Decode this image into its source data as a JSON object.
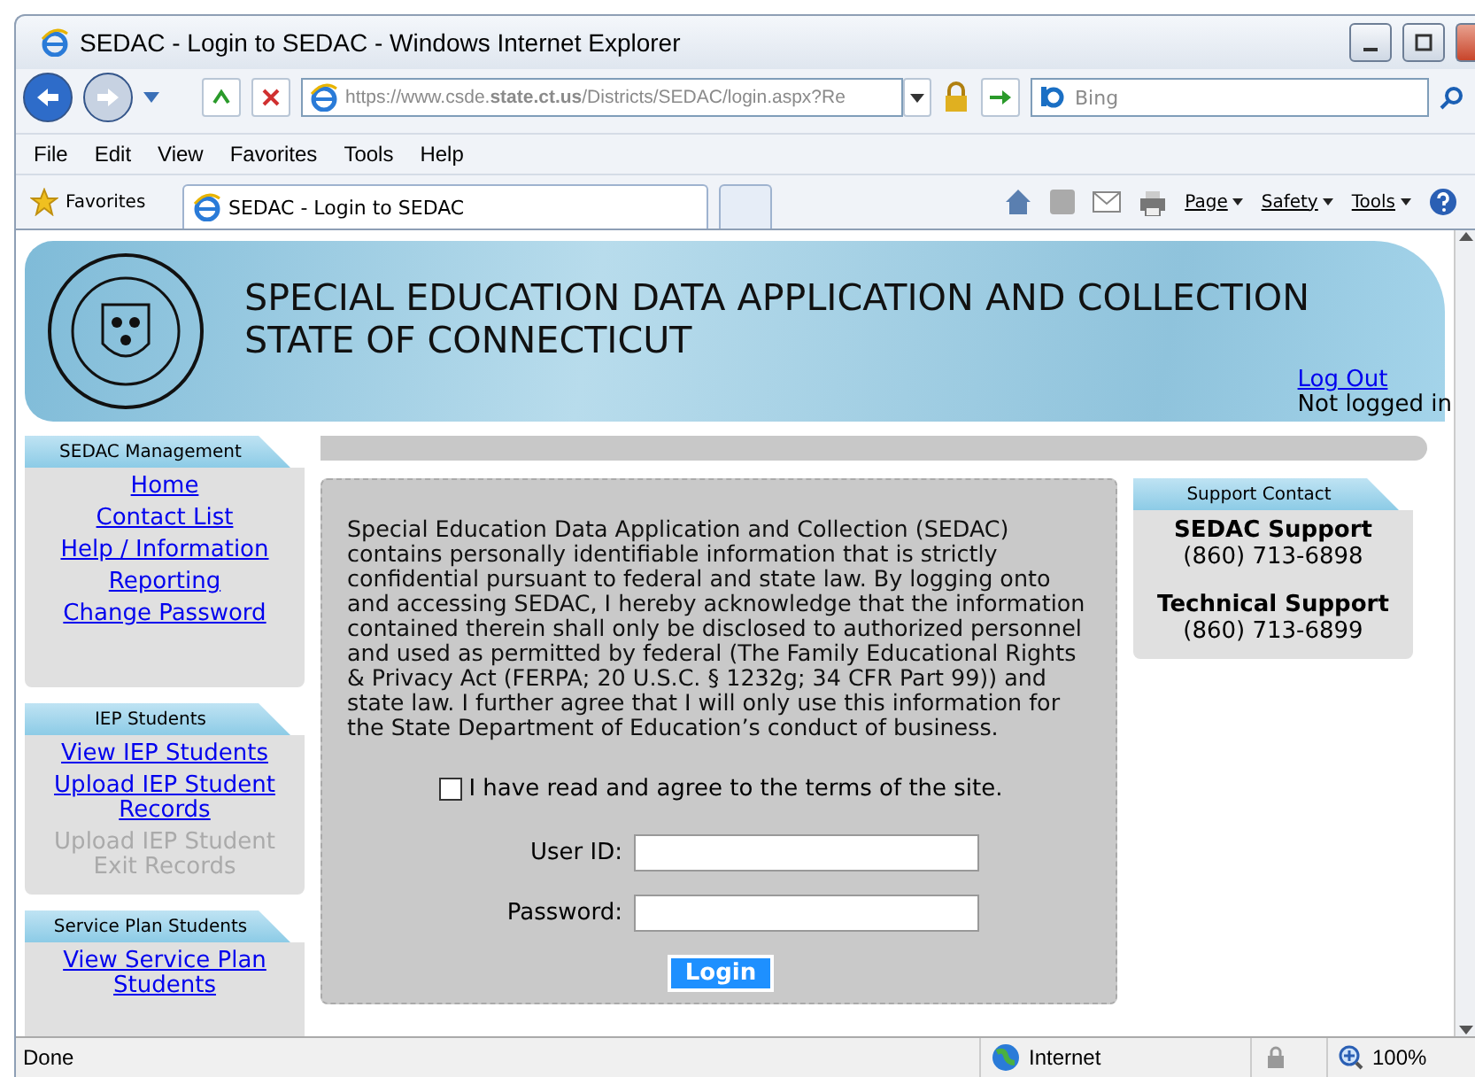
{
  "window": {
    "title": "SEDAC - Login to SEDAC - Windows Internet Explorer"
  },
  "address_bar": {
    "url": "https://www.csde.**state.ct.us**/Districts/SEDAC/login.aspx?Re",
    "search_placeholder": "Bing"
  },
  "menu": [
    "File",
    "Edit",
    "View",
    "Favorites",
    "Tools",
    "Help"
  ],
  "favorites_bar": {
    "favorites": "Favorites",
    "tab": "SEDAC - Login to SEDAC",
    "commands": [
      "Page",
      "Safety",
      "Tools"
    ]
  },
  "header": {
    "title_lines": [
      "SPECIAL EDUCATION DATA APPLICATION AND COLLECTION",
      "STATE OF CONNECTICUT"
    ],
    "logout": "Log Out",
    "login_status": "Not logged in"
  },
  "sidebar": [
    {
      "title": "SEDAC Management",
      "items": [
        {
          "label": "Home",
          "disabled": false
        },
        {
          "label": "Contact List",
          "disabled": false
        },
        {
          "label": "Help / Information",
          "disabled": false
        },
        {
          "label": "Reporting",
          "disabled": false
        },
        {
          "label": "Change Password",
          "disabled": false
        }
      ]
    },
    {
      "title": "IEP Students",
      "items": [
        {
          "label": "View IEP Students",
          "disabled": false
        },
        {
          "label": "Upload IEP Student Records",
          "disabled": false
        },
        {
          "label": "Upload IEP Student Exit Records",
          "disabled": true
        }
      ]
    },
    {
      "title": "Service Plan Students",
      "items": [
        {
          "label": "View Service Plan Students",
          "disabled": false
        }
      ]
    }
  ],
  "login": {
    "notice": "Special Education Data Application and Collection (SEDAC) contains personally identifiable information that is strictly confidential pursuant to federal and state law. By logging onto and accessing SEDAC, I hereby acknowledge that the information contained therein shall only be disclosed to authorized personnel and used as permitted by federal (The Family Educational Rights & Privacy Act (FERPA; 20 U.S.C. § 1232g; 34 CFR Part 99)) and state law. I further agree that I will only use this information for the State Department of Education’s conduct of business.",
    "agree": {
      "label": "I have read and agree to the terms of the site.",
      "checked": false
    },
    "fields": [
      {
        "label": "User ID:"
      },
      {
        "label": "Password:"
      }
    ],
    "button": "Login"
  },
  "support": {
    "title": "Support Contact",
    "contacts": [
      {
        "name": "SEDAC Support",
        "phone": "(860) 713-6898"
      },
      {
        "name": "Technical Support",
        "phone": "(860) 713-6899"
      }
    ]
  },
  "status_bar": {
    "text": "Done",
    "zone": "Internet",
    "zoom": "100%"
  }
}
